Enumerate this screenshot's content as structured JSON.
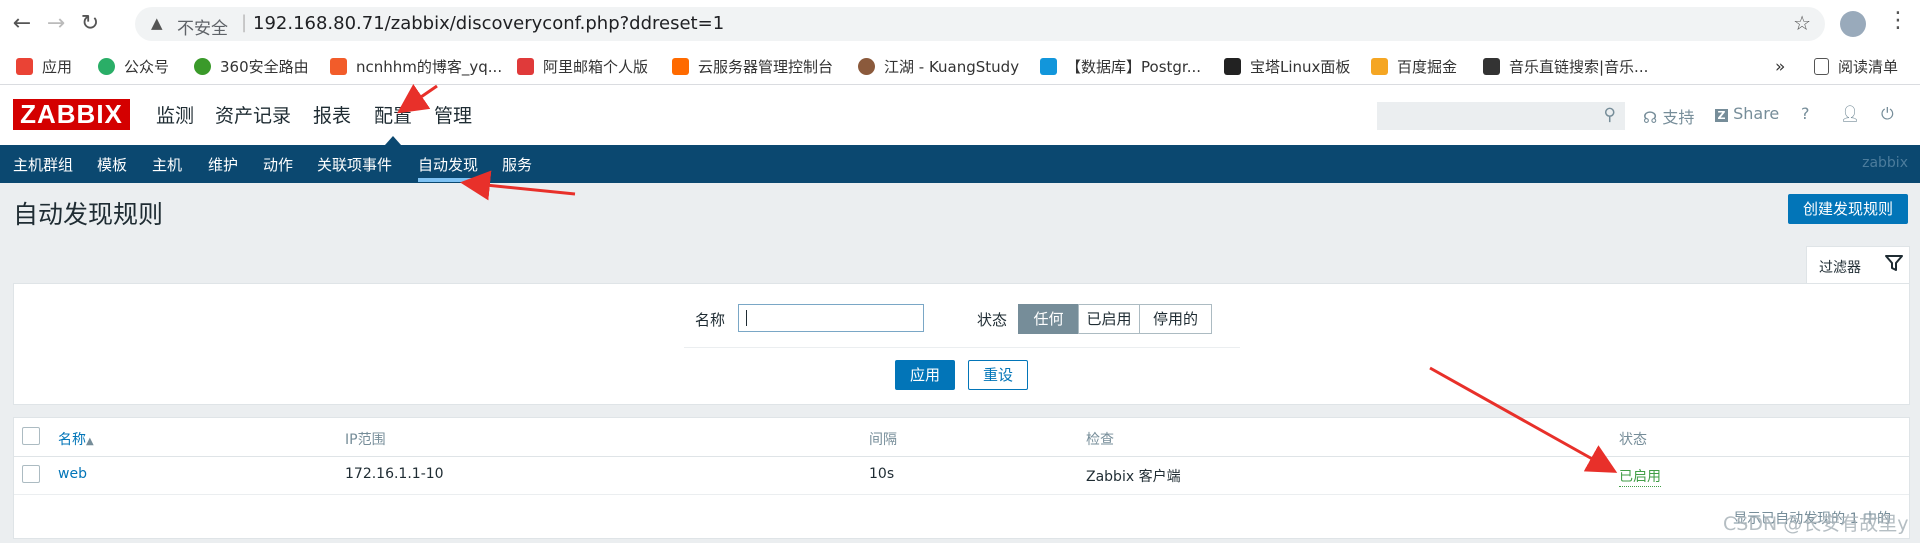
{
  "browser": {
    "insecure_label": "不安全",
    "url": "192.168.80.71/zabbix/discoveryconf.php?ddreset=1",
    "bookmarks": [
      {
        "label": "应用",
        "color": "#ea4335"
      },
      {
        "label": "公众号",
        "color": "#2aae67"
      },
      {
        "label": "360安全路由",
        "color": "#3a9a2a"
      },
      {
        "label": "ncnhhm的博客_yq...",
        "color": "#f25c2a"
      },
      {
        "label": "阿里邮箱个人版",
        "color": "#e03a3a"
      },
      {
        "label": "云服务器管理控制台",
        "color": "#ff6a00"
      },
      {
        "label": "江湖 - KuangStudy",
        "color": "#8b5a3c"
      },
      {
        "label": "【数据库】Postgr...",
        "color": "#1296db"
      },
      {
        "label": "宝塔Linux面板",
        "color": "#222222"
      },
      {
        "label": "百度掘金",
        "color": "#f5a623"
      },
      {
        "label": "音乐直链搜索|音乐...",
        "color": "#333333"
      }
    ],
    "more_label": "»",
    "reading_list": "阅读清单"
  },
  "header": {
    "logo": "ZABBIX",
    "menu": [
      "监测",
      "资产记录",
      "报表",
      "配置",
      "管理"
    ],
    "active_menu": "配置",
    "support": "支持",
    "share": "Share",
    "help": "?"
  },
  "submenu": {
    "items": [
      "主机群组",
      "模板",
      "主机",
      "维护",
      "动作",
      "关联项事件",
      "自动发现",
      "服务"
    ],
    "active": "自动发现",
    "server_name": "zabbix"
  },
  "page": {
    "title": "自动发现规则",
    "create_button": "创建发现规则",
    "filter_tab": "过滤器"
  },
  "filter": {
    "name_label": "名称",
    "name_value": "",
    "status_label": "状态",
    "status_options": [
      "任何",
      "已启用",
      "停用的"
    ],
    "status_selected": "任何",
    "apply": "应用",
    "reset": "重设"
  },
  "table": {
    "columns": [
      "名称",
      "IP范围",
      "间隔",
      "检查",
      "状态"
    ],
    "sort_indicator": "▲",
    "rows": [
      {
        "name": "web",
        "ip_range": "172.16.1.1-10",
        "interval": "10s",
        "checks": "Zabbix 客户端",
        "status": "已启用"
      }
    ],
    "footer": "显示已自动发现的 1 中的"
  },
  "watermark": "CSDN @长安有故里y",
  "colors": {
    "accent": "#0275b8",
    "nav_bg": "#0b4870",
    "logo_red": "#d40000",
    "status_enabled": "#429e47",
    "annotation_arrow": "#e8302a"
  }
}
